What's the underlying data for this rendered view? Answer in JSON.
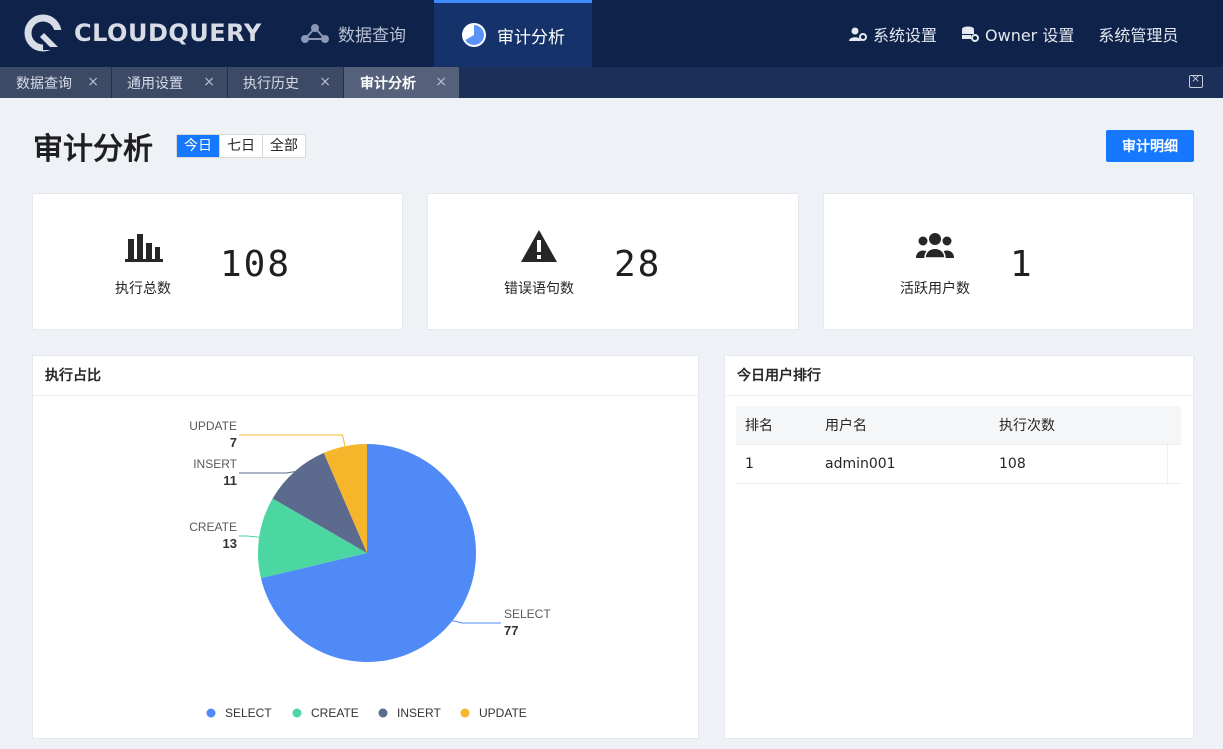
{
  "app": {
    "brand": "CLOUDQUERY",
    "nav_tabs": [
      {
        "label": "数据查询",
        "active": false
      },
      {
        "label": "审计分析",
        "active": true
      }
    ],
    "right_menu": [
      "系统设置",
      "Owner 设置",
      "系统管理员"
    ]
  },
  "tabs": [
    {
      "label": "数据查询",
      "active": false
    },
    {
      "label": "通用设置",
      "active": false
    },
    {
      "label": "执行历史",
      "active": false
    },
    {
      "label": "审计分析",
      "active": true
    }
  ],
  "tab_close_glyph": "×",
  "page": {
    "title": "审计分析",
    "ranges": [
      {
        "label": "今日",
        "active": true
      },
      {
        "label": "七日",
        "active": false
      },
      {
        "label": "全部",
        "active": false
      }
    ],
    "detail_button": "审计明细"
  },
  "stats": [
    {
      "label": "执行总数",
      "value": "108",
      "icon": "bar-chart-icon"
    },
    {
      "label": "错误语句数",
      "value": "28",
      "icon": "warning-icon"
    },
    {
      "label": "活跃用户数",
      "value": "1",
      "icon": "users-icon"
    }
  ],
  "pie_panel": {
    "title": "执行占比"
  },
  "rank_panel": {
    "title": "今日用户排行",
    "columns": [
      "排名",
      "用户名",
      "执行次数"
    ],
    "rows": [
      {
        "rank": "1",
        "user": "admin001",
        "count": "108"
      }
    ]
  },
  "chart_data": {
    "type": "pie",
    "categories": [
      "SELECT",
      "CREATE",
      "INSERT",
      "UPDATE"
    ],
    "values": [
      77,
      13,
      11,
      7
    ],
    "colors": [
      "#4f8af7",
      "#4cd6a1",
      "#5b6a8d",
      "#f6b62c"
    ],
    "legend": "bottom-center"
  },
  "colors": {
    "primary": "#1677ff",
    "topbar": "#0f2249",
    "tabstrip": "#1b2f58"
  }
}
